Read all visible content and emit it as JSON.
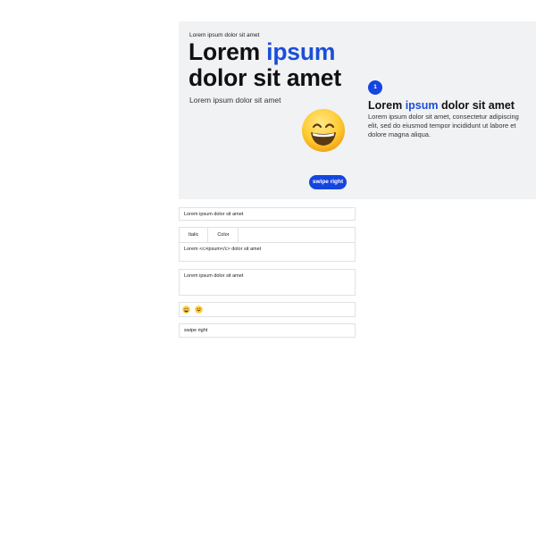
{
  "hero": {
    "kicker": "Lorem ipsum dolor sit amet",
    "title_part1": "Lorem ",
    "title_accent": "ipsum",
    "title_part2": "dolor sit amet",
    "subtitle": "Lorem ipsum dolor sit amet",
    "emoji_icon": "grinning-face-icon",
    "button_label": "swipe right",
    "step_number": "1",
    "side_title_part1": "Lorem ",
    "side_title_accent": "ipsum",
    "side_title_part2": " dolor sit amet",
    "side_body": "Lorem ipsum dolor sit amet, consectetur adipiscing elit, sed do eiusmod tempor incididunt ut labore et dolore magna aliqua."
  },
  "editor": {
    "kicker_value": "Lorem ipsum dolor sit amet",
    "title_tabs": [
      "Italic",
      "Color"
    ],
    "title_value": "Lorem <c>ipsum</c> dolor sit amet",
    "subtitle_value": "Lorem ipsum dolor sit amet",
    "emoji_options": [
      "grinning-face-icon",
      "smiling-face-icon"
    ],
    "button_value": "swipe right"
  },
  "colors": {
    "accent": "#1445e0",
    "card_bg": "#f1f2f4",
    "border": "#dfe1e4"
  }
}
